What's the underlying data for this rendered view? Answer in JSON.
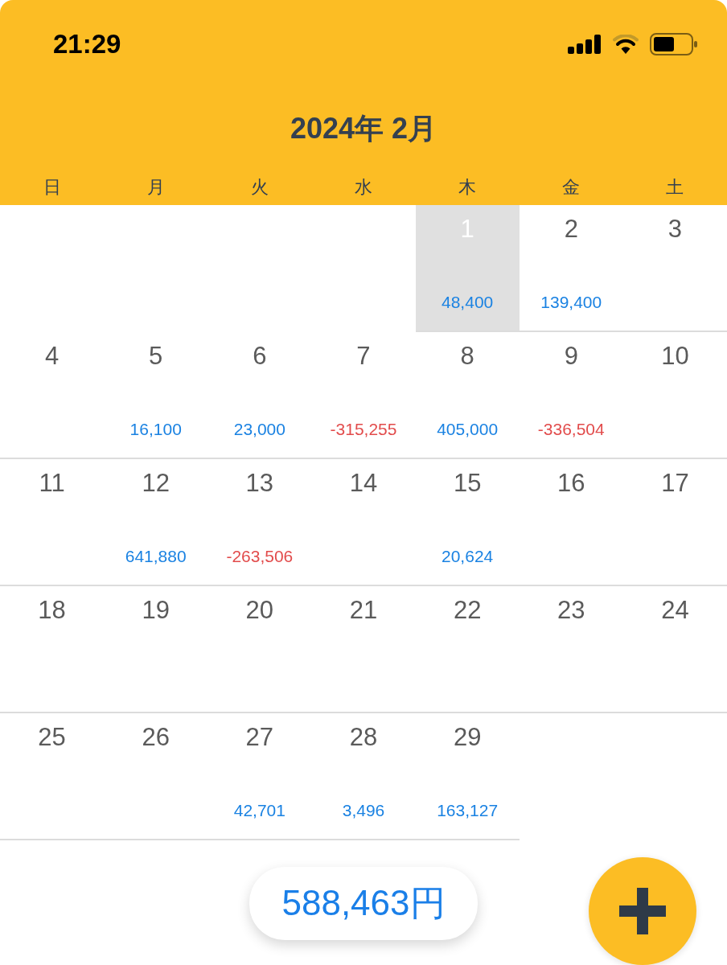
{
  "status_bar": {
    "time": "21:29"
  },
  "header": {
    "title": "2024年 2月",
    "weekdays": [
      "日",
      "月",
      "火",
      "水",
      "木",
      "金",
      "土"
    ]
  },
  "weeks": [
    {
      "days": [
        {
          "kind": "blank"
        },
        {
          "kind": "blank"
        },
        {
          "kind": "blank"
        },
        {
          "kind": "blank"
        },
        {
          "kind": "day",
          "date": "1",
          "selected": true,
          "amount": "48,400",
          "color": "#1a82e2"
        },
        {
          "kind": "day",
          "date": "2",
          "selected": false,
          "amount": "139,400",
          "color": "#1a82e2"
        },
        {
          "kind": "day",
          "date": "3",
          "selected": false
        }
      ]
    },
    {
      "days": [
        {
          "kind": "day",
          "date": "4",
          "selected": false
        },
        {
          "kind": "day",
          "date": "5",
          "selected": false,
          "amount": "16,100",
          "color": "#1a82e2"
        },
        {
          "kind": "day",
          "date": "6",
          "selected": false,
          "amount": "23,000",
          "color": "#1a82e2"
        },
        {
          "kind": "day",
          "date": "7",
          "selected": false,
          "amount": "-315,255",
          "color": "#e24c4c"
        },
        {
          "kind": "day",
          "date": "8",
          "selected": false,
          "amount": "405,000",
          "color": "#1a82e2"
        },
        {
          "kind": "day",
          "date": "9",
          "selected": false,
          "amount": "-336,504",
          "color": "#e24c4c"
        },
        {
          "kind": "day",
          "date": "10",
          "selected": false
        }
      ]
    },
    {
      "days": [
        {
          "kind": "day",
          "date": "11",
          "selected": false
        },
        {
          "kind": "day",
          "date": "12",
          "selected": false,
          "amount": "641,880",
          "color": "#1a82e2"
        },
        {
          "kind": "day",
          "date": "13",
          "selected": false,
          "amount": "-263,506",
          "color": "#e24c4c"
        },
        {
          "kind": "day",
          "date": "14",
          "selected": false
        },
        {
          "kind": "day",
          "date": "15",
          "selected": false,
          "amount": "20,624",
          "color": "#1a82e2"
        },
        {
          "kind": "day",
          "date": "16",
          "selected": false
        },
        {
          "kind": "day",
          "date": "17",
          "selected": false
        }
      ]
    },
    {
      "days": [
        {
          "kind": "day",
          "date": "18",
          "selected": false
        },
        {
          "kind": "day",
          "date": "19",
          "selected": false
        },
        {
          "kind": "day",
          "date": "20",
          "selected": false
        },
        {
          "kind": "day",
          "date": "21",
          "selected": false
        },
        {
          "kind": "day",
          "date": "22",
          "selected": false
        },
        {
          "kind": "day",
          "date": "23",
          "selected": false
        },
        {
          "kind": "day",
          "date": "24",
          "selected": false
        }
      ]
    },
    {
      "days": [
        {
          "kind": "day",
          "date": "25",
          "selected": false
        },
        {
          "kind": "day",
          "date": "26",
          "selected": false
        },
        {
          "kind": "day",
          "date": "27",
          "selected": false,
          "amount": "42,701",
          "color": "#1a82e2"
        },
        {
          "kind": "day",
          "date": "28",
          "selected": false,
          "amount": "3,496",
          "color": "#1a82e2"
        },
        {
          "kind": "day",
          "date": "29",
          "selected": false,
          "amount": "163,127",
          "color": "#1a82e2"
        },
        {
          "kind": "blank"
        },
        {
          "kind": "blank"
        }
      ]
    }
  ],
  "total": {
    "amount": "588,463円"
  }
}
